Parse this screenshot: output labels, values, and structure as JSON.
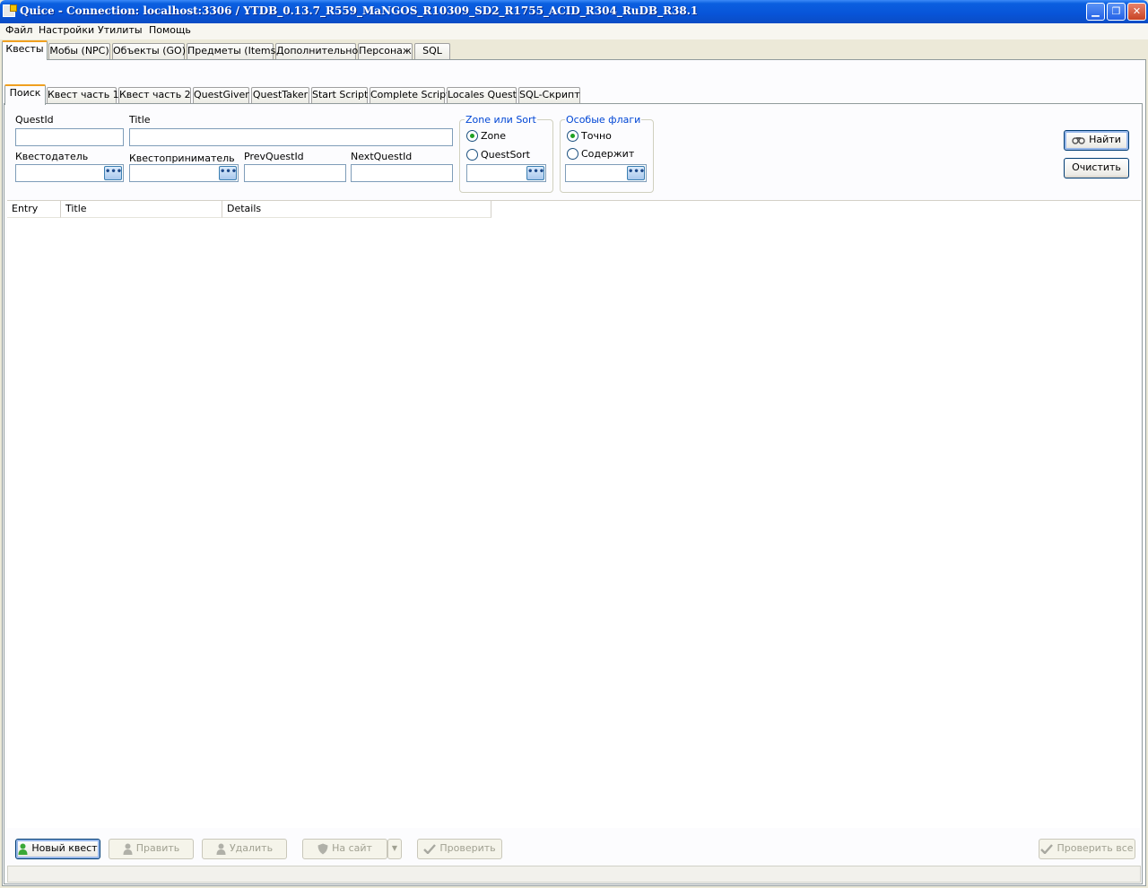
{
  "window": {
    "title": "Quice - Connection: localhost:3306 / YTDB_0.13.7_R559_MaNGOS_R10309_SD2_R1755_ACID_R304_RuDB_R38.1",
    "min_glyph": "▁",
    "max_glyph": "❐",
    "close_glyph": "✕"
  },
  "menu": [
    "Файл",
    "Настройки",
    "Утилиты",
    "Помощь"
  ],
  "main_tabs": [
    "Квесты",
    "Мобы (NPC)",
    "Объекты (GO)",
    "Предметы (Items)",
    "Дополнительно",
    "Персонаж",
    "SQL"
  ],
  "sub_tabs": [
    "Поиск",
    "Квест часть 1",
    "Квест часть 2",
    "QuestGiver",
    "QuestTaker",
    "Start Script",
    "Complete Script",
    "Locales Quest",
    "SQL-Скрипт"
  ],
  "search": {
    "questid_label": "QuestId",
    "questid_value": "",
    "title_label": "Title",
    "title_value": "",
    "giver_label": "Квестодатель",
    "giver_value": "",
    "taker_label": "Квестоприниматель",
    "taker_value": "",
    "prev_label": "PrevQuestId",
    "prev_value": "",
    "next_label": "NextQuestId",
    "next_value": "",
    "ellipsis": "•••"
  },
  "zone_group": {
    "title": "Zone или Sort",
    "option_zone": "Zone",
    "option_sort": "QuestSort",
    "selected": "Zone",
    "value": ""
  },
  "flags_group": {
    "title": "Особые флаги",
    "option_exact": "Точно",
    "option_contains": "Содержит",
    "selected": "Точно",
    "value": ""
  },
  "actions": {
    "find": "Найти",
    "clear": "Очистить"
  },
  "results": {
    "columns": [
      "Entry",
      "Title",
      "Details"
    ],
    "rows": []
  },
  "bottom": {
    "new_quest": "Новый квест",
    "edit": "Править",
    "delete": "Удалить",
    "to_site": "На сайт",
    "check": "Проверить",
    "check_all": "Проверить все"
  },
  "colors": {
    "title_bar": "#0854d8",
    "active_tab_accent": "#f0a020",
    "group_title": "#0046d5",
    "radio_dot": "#21a121"
  }
}
